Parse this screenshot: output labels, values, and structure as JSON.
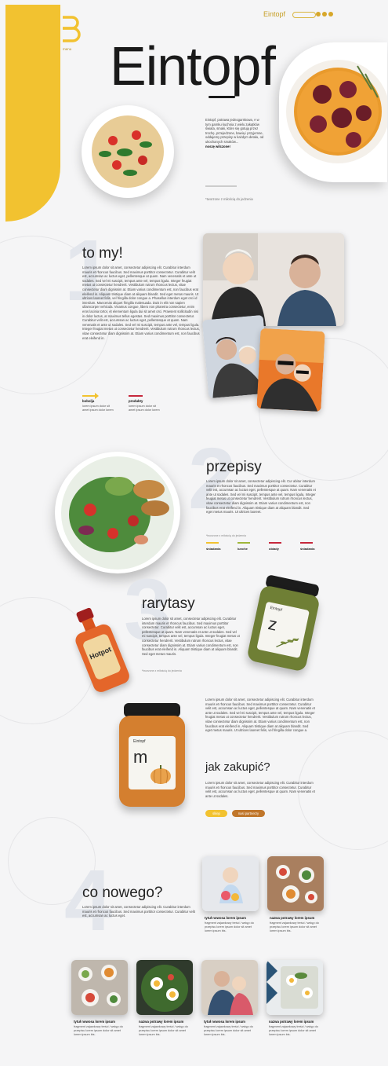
{
  "header": {
    "menu_label": "menu",
    "nav_brand": "Eintopf",
    "logo_text": "Eintopf",
    "social_icons": [
      "circle-icon",
      "circle-icon",
      "circle-icon"
    ]
  },
  "hero": {
    "intro_brand": "Eintopf",
    "intro_text": "Eintopf, potrawa jednogarnkowa, A w tym garnku kuchnia z wielu zakątków świata, smaki, które się gotują przez trochę, przejedzone, bawią i przyjemne, oddajemy przepisy w każdym detalu, od ukochanych smaków...",
    "intro_bold": "noszę wilczone!",
    "footnote": "*tworzone z miłością do jedzenia"
  },
  "section1": {
    "number": "1",
    "title": "to my!",
    "body": "Lorem ipsum dolor sit amet, consectetur adipiscing elit. Curabitur interdum mauris et rhoncus faucibus. Sed maximus porttitor consectetur. Curabitur velit est, accumsan ac luctus eget, pellentesque at quam. Nam venenatis et ante ut sodales. Sed vel mi suscipit, tempus ante vel, tempus ligula. Integer feugiat metus ut consectetur hendrerit. Vestibulum rutrum rhoncus lectus, vitae consectetur diam dignissim at. Etiam varius condimentum est, non faucibus erat eleifend in. Aliquam tristique diam at aliquam blandit. Sed eget metus mauris. Ut ultrices laoreet felis, vel fringilla dolor congue a. Phasellus interdum eget orci id interdum. Maecenas aliquet fringilla malesuada. Duis in elit non sapien ullamcorper vehicula. Vivamus congue, libero non pharetra consectetur, enim eros lacinia tortor, et elementum ligula dui sit amet orci. Praesent sollicitudin nisi in dolor luctus, at maximus tellus egestas. Sed maximus porttitor consectetur. Curabitur velit est, accumsan ac luctus eget, pellentesque at quam. Nam venenatis et ante ut sodales. Sed vel mi suscipit, tempus ante vel, tempus ligula. Integer feugiat metus ut consectetur hendrerit. Vestibulum rutrum rhoncus lectus, vitae consectetur diam dignissim at. Etiam varius condimentum est, non faucibus erat eleifend in.",
    "col1_title": "bobolja",
    "col1_text": "lorem ipsum dolor sit amet ipsum dolor lorem",
    "col2_title": "produkty",
    "col2_text": "lorem ipsum dolor sit amet ipsum dolor lorem"
  },
  "section2": {
    "number": "2",
    "title": "przepisy",
    "body": "Lorem ipsum dolor sit amet, consectetur adipiscing elit. Cur abitur interdum mauris et rhoncus faucibus. Sed maximus porttitor consectetur. Curabitur velit est, accumsan ac luctus eget, pellentesque at quam. Nam venenatis et ante ut sodales. Sed vel mi suscipit, tempus ante vel, tempus ligula. Integer feugiat metus ut consectetur hendrerit. Vestibulum rutrum rhoncus lectus, vitae consectetur diam dignissim at. Etiam varius condimentum est, non faucibus erat eleifend in. Aliquam tristique diam at aliquam blandit. Sed eget metus mauris. Ut ultrices laoreet.",
    "footnote": "*tworzone z miłością do jedzenia",
    "categories": [
      {
        "label": "śniadania",
        "color": "#f2c230"
      },
      {
        "label": "lunche",
        "color": "#a0b73a"
      },
      {
        "label": "obiady",
        "color": "#c6283c"
      },
      {
        "label": "śniadania",
        "color": "#c6283c"
      }
    ]
  },
  "section3": {
    "number": "3",
    "title": "rarytasy",
    "body": "Lorem ipsum dolor sit amet, consectetur adipiscing elit. Curabitur interdum mauris et rhoncus faucibus. Sed maximus porttitor consectetur. Curabitur velit est, accumsan ac luctus eget, pellentesque at quam. Nam venenatis et ante ut sodales. Sed vel mi suscipit, tempus ante vel, tempus ligula. Integer feugiat metus ut consectetur hendrerit. Vestibulum rutrum rhoncus lectus, vitae consectetur diam dignissim at. Etiam varius condimentum est, non faucibus erat eleifend in. Aliquam tristique diam at aliquam blandit. Sed eget metus mauris.",
    "footnote": "*tworzone z miłością do jedzenia",
    "sauce_label": "Hotpot",
    "jar_letter": "z",
    "jar_brand": "Eintopf",
    "jar2_letter": "m",
    "jar2_brand": "Eintopf",
    "body2": "Lorem ipsum dolor sit amet, consectetur adipiscing elit. Curabitur interdum mauris et rhoncus faucibus. Sed maximus porttitor consectetur. Curabitur velit est, accumsan ac luctus eget, pellentesque at quam. Nam venenatis et ante ut sodales. Sed vel mi suscipit, tempus ante vel, tempus ligula. Integer feugiat metus ut consectetur hendrerit. Vestibulum rutrum rhoncus lectus, vitae consectetur diam dignissim at. Etiam varius condimentum est, non faucibus erat eleifend in. Aliquam tristique diam at aliquam blandit. Sed eget metus mauris. Ut ultrices laoreet felis, vel fringilla dolor congue a.",
    "buy_title": "jak zakupić?",
    "buy_body": "Lorem ipsum dolor sit amet, consectetur adipiscing elit. Curabitur interdum mauris et rhoncus faucibus. Sed maximus porttitor consectetur. Curabitur velit est, accumsan ac luctus eget, pellentesque at quam. Nam venenatis et ante ut sodales.",
    "btn_shop": "sklep",
    "btn_partners": "nasi partnerzy",
    "btn_shop_color": "#f2c230",
    "btn_partners_color": "#c0762a"
  },
  "section4": {
    "number": "4",
    "title": "co nowego?",
    "body": "Lorem ipsum dolor sit amet, consectetur adipiscing elit. Curabitur interdum mauris et rhoncus faucibus. Sed maximus porttitor consectetur. Curabitur velit est, accumsan ac luctus eget.",
    "cards_top": [
      {
        "title": "tytuł nowosa lorem ipsum",
        "text": "fragment zajawkowy treści / wstęp do przepisu lorem ipsum dolor sit amet lorem ipsum bis."
      },
      {
        "title": "nazwa potrawy lorem ipsum",
        "text": "fragment zajawkowy treści / wstęp do przepisu lorem ipsum dolor sit amet lorem ipsum bis."
      }
    ],
    "cards_bottom": [
      {
        "title": "tytuł nowosa lorem ipsum",
        "text": "fragment zajawkowy treści / wstęp do przepisu lorem ipsum dolor sit amet lorem ipsum bis."
      },
      {
        "title": "nazwa potrawy lorem ipsum",
        "text": "fragment zajawkowy treści / wstęp do przepisu lorem ipsum dolor sit amet lorem ipsum bis."
      },
      {
        "title": "tytuł nowosa lorem ipsum",
        "text": "fragment zajawkowy treści / wstęp do przepisu lorem ipsum dolor sit amet lorem ipsum bis."
      },
      {
        "title": "nazwa potrawy lorem ipsum",
        "text": "fragment zajawkowy treści / wstęp do przepisu lorem ipsum dolor sit amet lorem ipsum bis."
      }
    ]
  },
  "colors": {
    "accent_yellow": "#f2c230",
    "accent_red": "#c6283c",
    "accent_green": "#a0b73a"
  }
}
